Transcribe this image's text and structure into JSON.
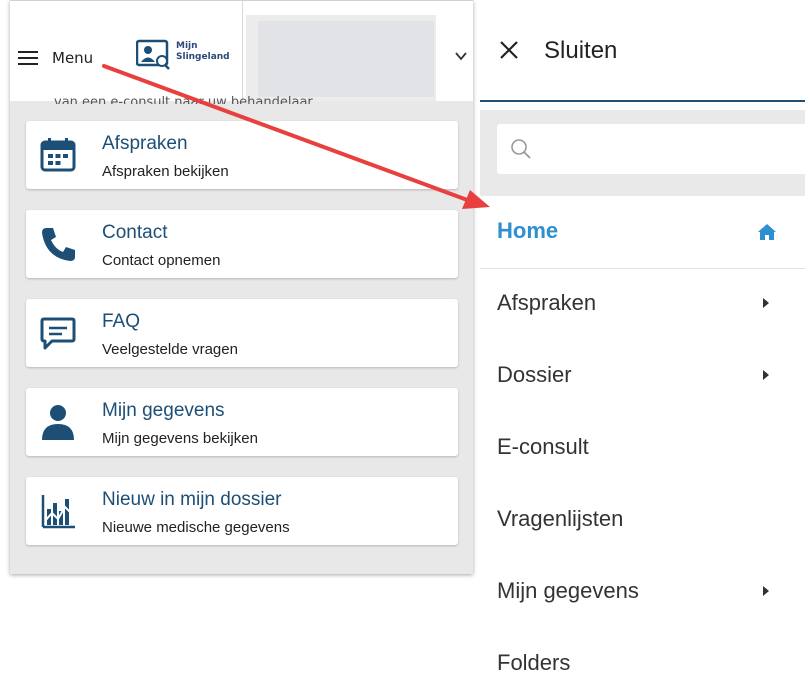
{
  "left_panel": {
    "menu_label": "Menu",
    "logo_text_line1": "Mijn",
    "logo_text_line2": "Slingeland",
    "peek_text": "van een e-consult naar uw behandelaar",
    "cards": [
      {
        "title": "Afspraken",
        "subtitle": "Afspraken bekijken",
        "icon": "calendar-icon"
      },
      {
        "title": "Contact",
        "subtitle": "Contact opnemen",
        "icon": "phone-icon"
      },
      {
        "title": "FAQ",
        "subtitle": "Veelgestelde vragen",
        "icon": "chat-icon"
      },
      {
        "title": "Mijn gegevens",
        "subtitle": "Mijn gegevens bekijken",
        "icon": "person-icon"
      },
      {
        "title": "Nieuw in mijn dossier",
        "subtitle": "Nieuwe medische gegevens",
        "icon": "chart-icon"
      }
    ]
  },
  "right_panel": {
    "close_label": "Sluiten",
    "search_placeholder": "",
    "nav_items": [
      {
        "label": "Home",
        "active": true,
        "has_submenu": false,
        "icon": "home-icon"
      },
      {
        "label": "Afspraken",
        "active": false,
        "has_submenu": true
      },
      {
        "label": "Dossier",
        "active": false,
        "has_submenu": true
      },
      {
        "label": "E-consult",
        "active": false,
        "has_submenu": false
      },
      {
        "label": "Vragenlijsten",
        "active": false,
        "has_submenu": false
      },
      {
        "label": "Mijn gegevens",
        "active": false,
        "has_submenu": true
      },
      {
        "label": "Folders",
        "active": false,
        "has_submenu": false
      }
    ]
  },
  "colors": {
    "brand_dark_blue": "#1d4f76",
    "active_blue": "#2f8fd0",
    "arrow_red": "#e8413d"
  }
}
